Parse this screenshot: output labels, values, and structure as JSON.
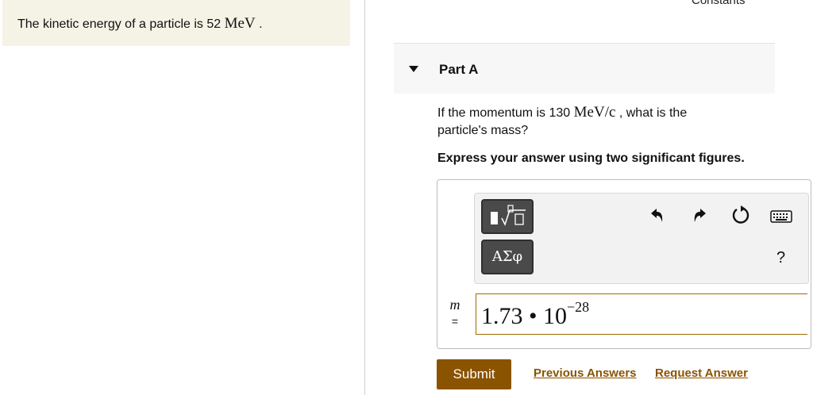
{
  "problem": {
    "prefix": "The kinetic energy of a particle is 52 ",
    "unit": "MeV",
    "suffix": " ."
  },
  "header": {
    "constants_link": "Constants"
  },
  "part": {
    "label": "Part A"
  },
  "question": {
    "prefix": "If the momentum is 130 ",
    "unit": "MeV/c",
    "suffix": " , what is the particle's mass?"
  },
  "instruction": "Express your answer using two significant figures.",
  "toolbar": {
    "greek_label": "ΑΣφ",
    "help_label": "?",
    "icons": [
      "templates-icon",
      "undo-icon",
      "redo-icon",
      "reset-icon",
      "keyboard-icon"
    ]
  },
  "answer": {
    "variable": "m",
    "equals": "=",
    "mantissa": "1.73 • 10",
    "exponent": "−28"
  },
  "actions": {
    "submit": "Submit",
    "previous_answers": "Previous Answers",
    "request_answer": "Request Answer"
  },
  "colors": {
    "accent": "#8a5300",
    "problem_bg": "#f5f3e5"
  }
}
